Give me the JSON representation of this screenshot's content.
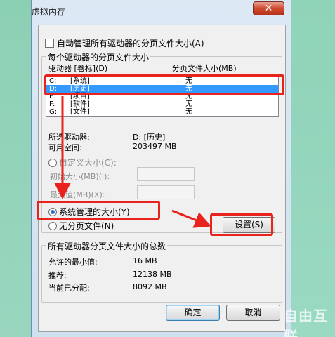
{
  "window": {
    "title": "虚拟内存",
    "close_glyph": "✕"
  },
  "auto_manage": {
    "label": "自动管理所有驱动器的分页文件大小(A)",
    "checked": false
  },
  "per_drive": {
    "group_label": "每个驱动器的分页文件大小",
    "col_drive": "驱动器 [卷标](D)",
    "col_size": "分页文件大小(MB)",
    "drives": [
      {
        "letter": "C:",
        "volume": "[系统]",
        "size": "无"
      },
      {
        "letter": "D:",
        "volume": "[历史]",
        "size": "无",
        "selected": true
      },
      {
        "letter": "E:",
        "volume": "[项目]",
        "size": "无"
      },
      {
        "letter": "F:",
        "volume": "[软件]",
        "size": "无"
      },
      {
        "letter": "G:",
        "volume": "[文件]",
        "size": "无"
      }
    ],
    "selected_drive_label": "所选驱动器:",
    "selected_drive_value": "D:  [历史]",
    "free_space_label": "可用空间:",
    "free_space_value": "203497 MB",
    "custom_size_label": "自定义大小(C):",
    "initial_size_label": "初始大小(MB)(I):",
    "max_size_label": "最大值(MB)(X):",
    "system_managed_label": "系统管理的大小(Y)",
    "no_paging_label": "无分页文件(N)",
    "set_button": "设置(S)"
  },
  "totals": {
    "group_label": "所有驱动器分页文件大小的总数",
    "min_label": "允许的最小值:",
    "min_value": "16 MB",
    "recommended_label": "推荐:",
    "recommended_value": "12138 MB",
    "current_label": "当前已分配:",
    "current_value": "8092 MB"
  },
  "buttons": {
    "ok": "确定",
    "cancel": "取消"
  },
  "watermark": "自由互联",
  "colors": {
    "highlight": "#e8221c",
    "selection": "#3399ff"
  }
}
